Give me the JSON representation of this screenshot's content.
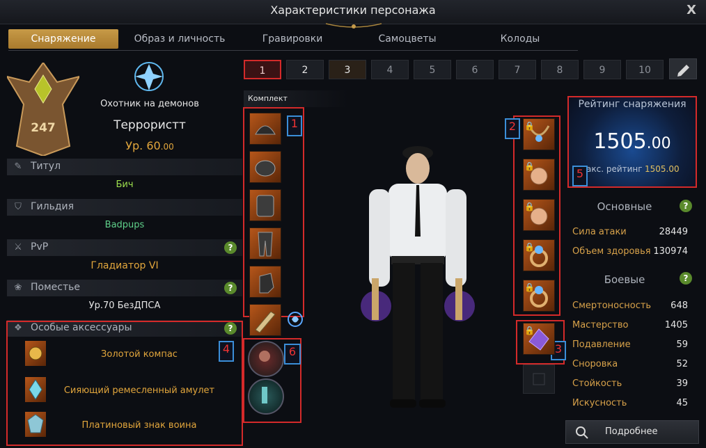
{
  "window": {
    "title": "Характеристики персонажа",
    "close": "X"
  },
  "tabs": [
    "Снаряжение",
    "Образ и личность",
    "Гравировки",
    "Самоцветы",
    "Колоды"
  ],
  "character": {
    "roster_level": "247",
    "class": "Охотник на демонов",
    "name": "Террористт",
    "level_label": "Ур. 60",
    "level_frac": ".00"
  },
  "info": {
    "title_label": "Титул",
    "title_value": "Бич",
    "guild_label": "Гильдия",
    "guild_value": "Badpups",
    "pvp_label": "PvP",
    "pvp_value": "Гладиатор VI",
    "estate_label": "Поместье",
    "estate_value": "Ур.70 БезДПСА"
  },
  "accessories": {
    "label": "Особые аксессуары",
    "items": [
      "Золотой компас",
      "Сияющий ремесленный амулет",
      "Платиновый знак воина"
    ]
  },
  "presets": [
    "1",
    "2",
    "3",
    "4",
    "5",
    "6",
    "7",
    "8",
    "9",
    "10"
  ],
  "set_label": "Комплект",
  "annotations": [
    "1",
    "2",
    "3",
    "4",
    "5",
    "6"
  ],
  "rating": {
    "label": "Рейтинг снаряжения",
    "value_int": "1505",
    "value_frac": ".00",
    "max_label": "акс. рейтинг",
    "max_value": "1505.00"
  },
  "basic": {
    "label": "Основные",
    "stats": [
      {
        "name": "Сила атаки",
        "value": "28449"
      },
      {
        "name": "Объем здоровья",
        "value": "130974"
      }
    ]
  },
  "combat": {
    "label": "Боевые",
    "stats": [
      {
        "name": "Смертоносность",
        "value": "648"
      },
      {
        "name": "Мастерство",
        "value": "1405"
      },
      {
        "name": "Подавление",
        "value": "59"
      },
      {
        "name": "Сноровка",
        "value": "52"
      },
      {
        "name": "Стойкость",
        "value": "39"
      },
      {
        "name": "Искусность",
        "value": "45"
      }
    ]
  },
  "details_button": "Подробнее",
  "colors": {
    "accent_gold": "#d8a24a",
    "annotation_red": "#d42a2a",
    "annotation_blue": "#3b8ed8",
    "tab_active": "#c79a47"
  }
}
